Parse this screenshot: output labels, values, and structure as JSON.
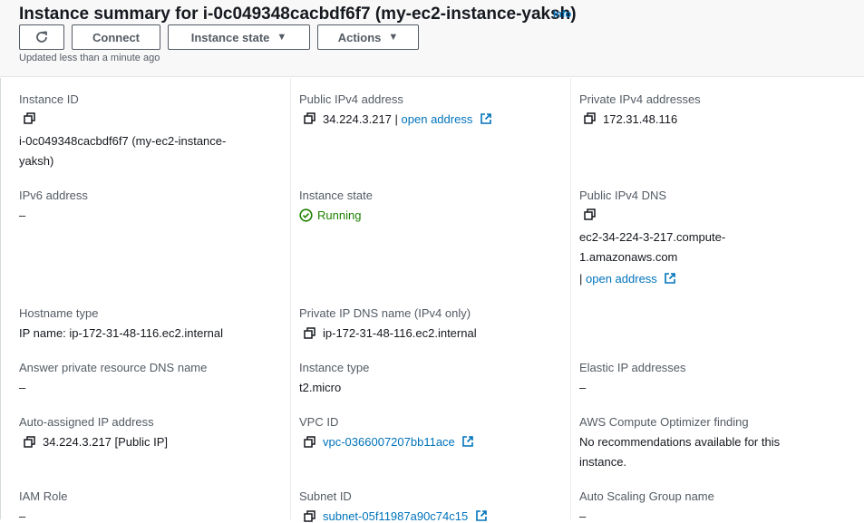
{
  "header": {
    "title": "Instance summary for i-0c049348cacbdf6f7 (my-ec2-instance-yaksh)",
    "info": "Info",
    "buttons": {
      "refresh": "↻",
      "connect": "Connect",
      "instance_state": "Instance state",
      "actions": "Actions"
    },
    "updated": "Updated less than a minute ago"
  },
  "fields": {
    "instance_id": {
      "label": "Instance ID",
      "line1": "i-0c049348cacbdf6f7 (my-ec2-instance-",
      "line2": "yaksh)"
    },
    "public_ipv4": {
      "label": "Public IPv4 address",
      "value": "34.224.3.217",
      "sep": "|",
      "link": "open address"
    },
    "private_ipv4": {
      "label": "Private IPv4 addresses",
      "value": "172.31.48.116"
    },
    "ipv6": {
      "label": "IPv6 address",
      "value": "–"
    },
    "instance_state": {
      "label": "Instance state",
      "value": "Running"
    },
    "public_dns": {
      "label": "Public IPv4 DNS",
      "line1": "ec2-34-224-3-217.compute-",
      "line2": "1.amazonaws.com",
      "sep": "|",
      "link": "open address"
    },
    "hostname_type": {
      "label": "Hostname type",
      "value": "IP name: ip-172-31-48-116.ec2.internal"
    },
    "private_dns": {
      "label": "Private IP DNS name (IPv4 only)",
      "value": "ip-172-31-48-116.ec2.internal"
    },
    "answer_dns": {
      "label": "Answer private resource DNS name",
      "value": "–"
    },
    "instance_type": {
      "label": "Instance type",
      "value": "t2.micro"
    },
    "elastic_ip": {
      "label": "Elastic IP addresses",
      "value": "–"
    },
    "auto_ip": {
      "label": "Auto-assigned IP address",
      "value": "34.224.3.217 [Public IP]"
    },
    "vpc_id": {
      "label": "VPC ID",
      "value": "vpc-0366007207bb11ace"
    },
    "optimizer": {
      "label": "AWS Compute Optimizer finding",
      "line1": "No recommendations available for this",
      "line2": "instance."
    },
    "iam_role": {
      "label": "IAM Role",
      "value": "–"
    },
    "subnet_id": {
      "label": "Subnet ID",
      "value": "subnet-05f11987a90c74c15"
    },
    "asg_name": {
      "label": "Auto Scaling Group name",
      "value": "–"
    }
  },
  "colors": {
    "link": "#0073bb",
    "running": "#1d8102",
    "label": "#545b64",
    "text": "#16191f"
  }
}
